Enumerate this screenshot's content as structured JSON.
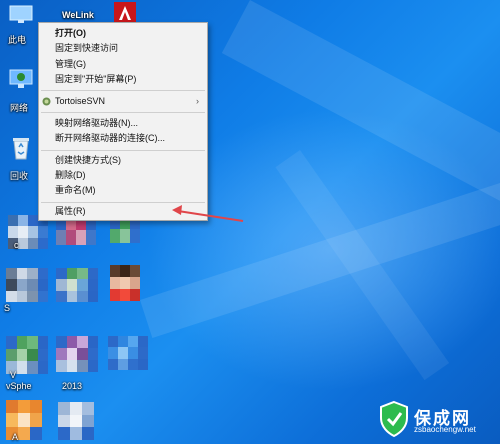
{
  "desktop": {
    "icon_labels": {
      "this_pc": "此电",
      "welink": "WeLink",
      "network": "网络",
      "recycle_bin": "回收",
      "c_label": "c",
      "s_label": "S",
      "v_label": "V",
      "vsphere": "vSphe",
      "year": "2013",
      "a_label": "A"
    }
  },
  "context_menu": {
    "items": [
      {
        "label": "打开(O)",
        "bold": true
      },
      {
        "label": "固定到快速访问"
      },
      {
        "label": "管理(G)"
      },
      {
        "label": "固定到\"开始\"屏幕(P)"
      },
      {
        "label": "TortoiseSVN",
        "submenu": true
      },
      {
        "label": "映射网络驱动器(N)..."
      },
      {
        "label": "断开网络驱动器的连接(C)..."
      },
      {
        "label": "创建快捷方式(S)"
      },
      {
        "label": "删除(D)"
      },
      {
        "label": "重命名(M)"
      },
      {
        "label": "属性(R)"
      }
    ],
    "submenu_glyph": "›"
  },
  "annotation": {
    "arrow_color": "#e0464a"
  },
  "watermark": {
    "brand": "保成网",
    "url": "zsbaochengw.net",
    "color": "#2dbb4e"
  }
}
